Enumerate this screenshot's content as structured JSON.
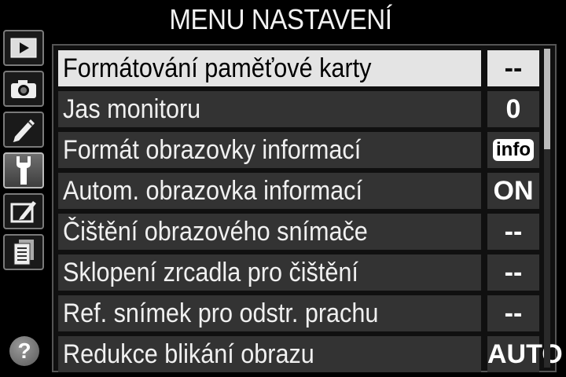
{
  "title": "MENU NASTAVENÍ",
  "tabs": [
    {
      "name": "playback-icon"
    },
    {
      "name": "camera-icon"
    },
    {
      "name": "pencil-icon"
    },
    {
      "name": "wrench-icon",
      "active": true
    },
    {
      "name": "retouch-icon"
    },
    {
      "name": "my-menu-icon"
    }
  ],
  "help": {
    "label": "?"
  },
  "menu": {
    "items": [
      {
        "label": "Formátování paměťové karty",
        "value": "--",
        "selected": true
      },
      {
        "label": "Jas monitoru",
        "value": "0"
      },
      {
        "label": "Formát obrazovky informací",
        "value": "info"
      },
      {
        "label": "Autom. obrazovka informací",
        "value": "ON"
      },
      {
        "label": "Čištění obrazového snímače",
        "value": "--"
      },
      {
        "label": "Sklopení zrcadla pro čištění",
        "value": "--"
      },
      {
        "label": "Ref. snímek pro odstr. prachu",
        "value": "--"
      },
      {
        "label": "Redukce blikání obrazu",
        "value": "AUTO"
      }
    ]
  },
  "colors": {
    "selected_bg": "#e4e4e4",
    "row_bg": "#333333",
    "background": "#000000"
  }
}
